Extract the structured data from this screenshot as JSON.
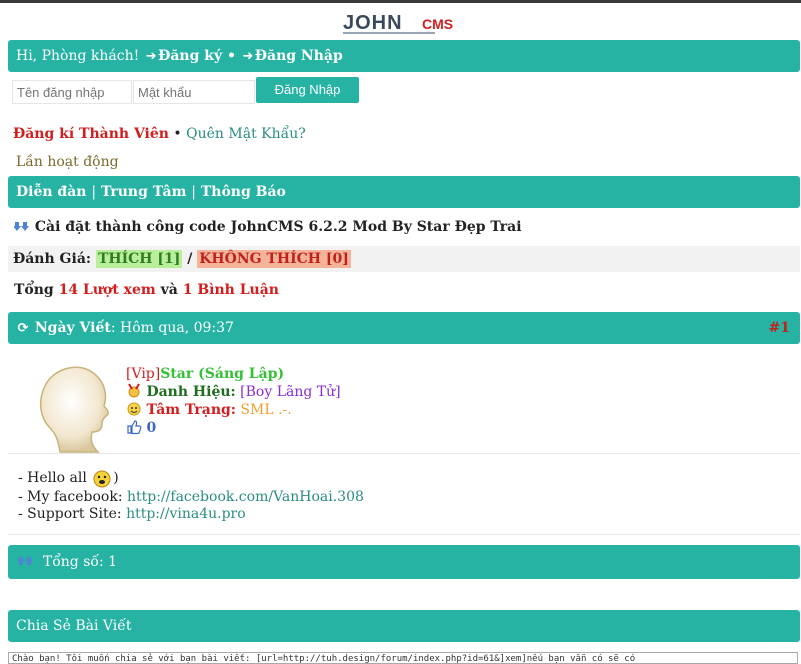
{
  "logo": {
    "text_main": "JOHN",
    "text_small": "CMS"
  },
  "header": {
    "greeting": "Hi, Phòng khách!",
    "register": "Đăng ký",
    "separator": "•",
    "login": "Đăng Nhập"
  },
  "login_form": {
    "username_placeholder": "Tên đăng nhập",
    "password_placeholder": "Mật khẩu",
    "submit_label": "Đăng Nhập"
  },
  "links": {
    "register_member": "Đăng kí Thành Viên",
    "separator": "•",
    "forgot_password": "Quên Mật Khẩu?"
  },
  "activity": "Lần hoạt động",
  "nav": {
    "items": [
      "Diễn đàn",
      "Trung Tâm",
      "Thông Báo"
    ],
    "separator": "|"
  },
  "topic": {
    "title": "Cài đặt thành công code JohnCMS 6.2.2 Mod By Star Đẹp Trai"
  },
  "rating": {
    "label": "Đánh Giá:",
    "like": "THÍCH [1]",
    "slash": "/",
    "dislike": "KHÔNG THÍCH [0]"
  },
  "stats": {
    "prefix": "Tổng",
    "views": "14 Lượt xem",
    "and": "và",
    "comments": "1 Bình Luận"
  },
  "post": {
    "date_label": "Ngày Viết",
    "date_value": ": Hôm qua, 09:37",
    "number": "#1",
    "author_prefix": "[Vip]",
    "author_name": "Star (Sáng Lập)",
    "title_label": "Danh Hiệu:",
    "title_value": "[Boy Lãng Tử]",
    "mood_label": "Tâm Trạng:",
    "mood_value": "SML .-.",
    "likes": "0",
    "content": {
      "line1_a": "- Hello all",
      "line1_b": ")",
      "line2_prefix": "- My facebook:",
      "line2_link": "http://facebook.com/VanHoai.308",
      "line3_prefix": "- Support Site:",
      "line3_link": "http://vina4u.pro"
    }
  },
  "total": {
    "label": "Tổng số: 1"
  },
  "share": {
    "title": "Chia Sẻ Bài Viết",
    "box_text": "Chào bạn! Tôi muốn chia sẻ với bạn bài viết: [url=http://tuh.design/forum/index.php?id=61&]xem]nếu bạn vẫn có sẽ có"
  },
  "colors": {
    "accent": "#26b3a4",
    "red": "#d21e1e",
    "green": "#35c035"
  }
}
